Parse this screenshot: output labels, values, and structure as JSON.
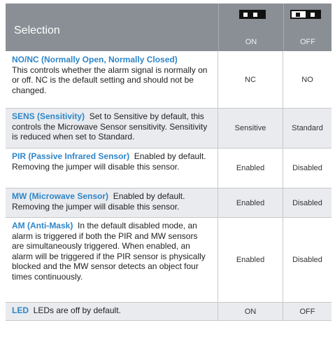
{
  "header": {
    "title": "Selection",
    "on_label": "ON",
    "off_label": "OFF"
  },
  "colors": {
    "header_bg": "#8a8f95",
    "term": "#2e86c9",
    "alt_row": "#e9ebee"
  },
  "rows": [
    {
      "term": "NO/NC (Normally Open, Normally Closed)",
      "desc": "This controls whether the alarm signal is normally on or off. NC is the default setting and should not be changed.",
      "on": "NC",
      "off": "NO"
    },
    {
      "term": "SENS (Sensitivity)",
      "desc": "Set to Sensitive by default, this controls the Microwave Sensor sensitivity. Sensitivity is reduced when set to Standard.",
      "on": "Sensitive",
      "off": "Standard"
    },
    {
      "term": "PIR (Passive Infrared Sensor)",
      "desc": "Enabled by default. Removing the jumper will disable this sensor.",
      "on": "Enabled",
      "off": "Disabled"
    },
    {
      "term": "MW (Microwave Sensor)",
      "desc": "Enabled by default. Removing the jumper will disable this sensor.",
      "on": "Enabled",
      "off": "Disabled"
    },
    {
      "term": "AM (Anti-Mask)",
      "desc": "In the default disabled mode, an alarm is triggered if both the PIR and MW sensors are simultaneously triggered. When enabled, an alarm will be triggered if the PIR sensor is physically blocked and the MW sensor detects an object four times continuously.",
      "on": "Enabled",
      "off": "Disabled"
    },
    {
      "term": "LED",
      "desc": "LEDs are off by default.",
      "on": "ON",
      "off": "OFF"
    }
  ]
}
